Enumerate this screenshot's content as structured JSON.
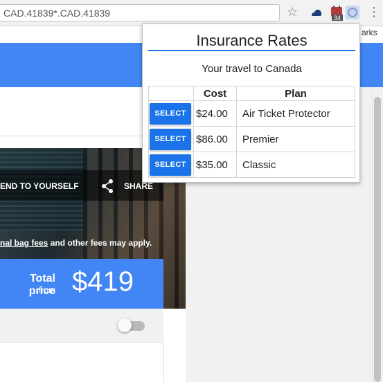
{
  "browser": {
    "url_text": "CAD.41839*.CAD.41839",
    "calendar_badge": "34",
    "bookmarks_fragment": "arks"
  },
  "page": {
    "send_to_yourself": "END TO YOURSELF",
    "share_label": "SHARE",
    "fees_link": "nal bag fees",
    "fees_rest": " and other fees may apply.",
    "total_price_label": "Total price",
    "from_label": "from",
    "price": "$419"
  },
  "popup": {
    "title": "Insurance Rates",
    "subtitle": "Your travel to Canada",
    "headers": {
      "select": "",
      "cost": "Cost",
      "plan": "Plan"
    },
    "rows": [
      {
        "button": "SELECT",
        "cost": "$24.00",
        "plan": "Air Ticket Protector"
      },
      {
        "button": "SELECT",
        "cost": "$86.00",
        "plan": "Premier"
      },
      {
        "button": "SELECT",
        "cost": "$35.00",
        "plan": "Classic"
      }
    ]
  },
  "colors": {
    "accent": "#4285f4",
    "button": "#1a73e8"
  },
  "icons": [
    "star-icon",
    "cloud-icon",
    "calendar-extension-icon",
    "circle-extension-icon",
    "menu-icon",
    "share-icon"
  ]
}
